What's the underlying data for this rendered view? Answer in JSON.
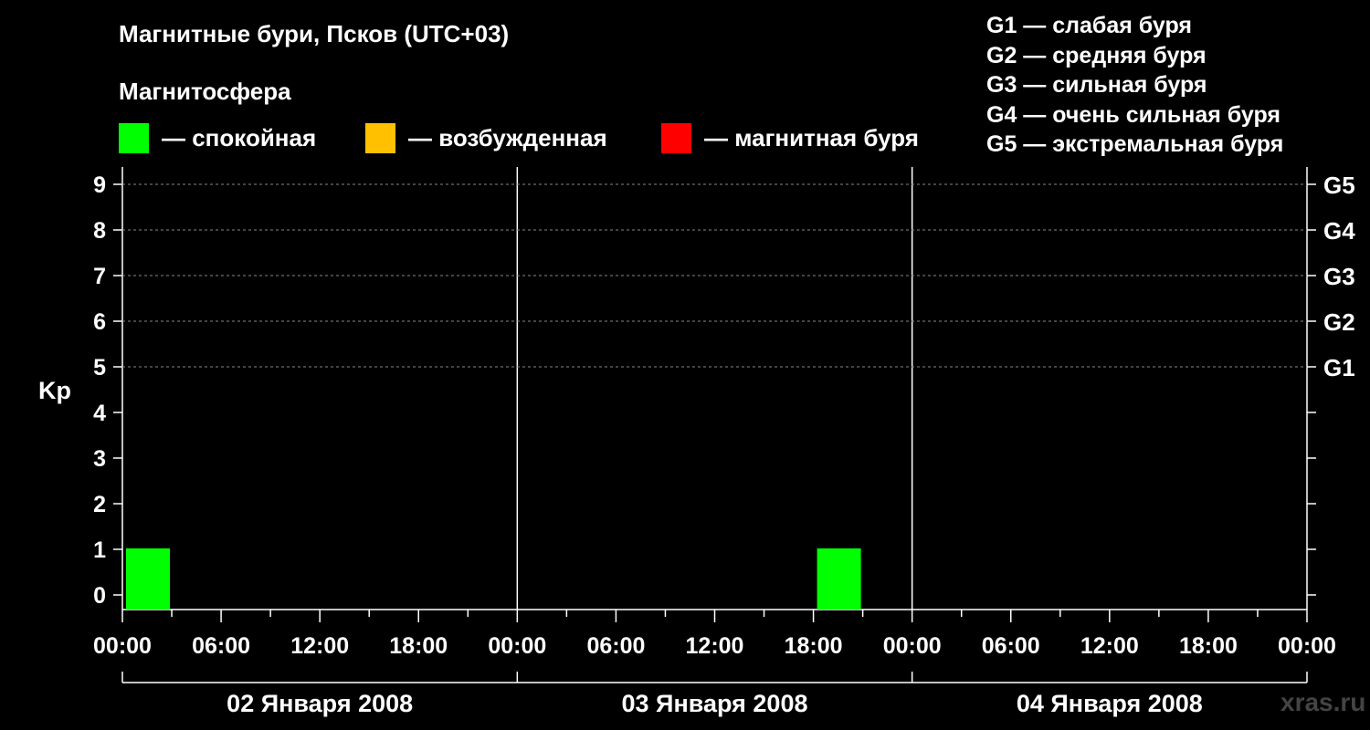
{
  "title": "Магнитные бури, Псков (UTC+03)",
  "subtitle": "Магнитосфера",
  "legend": [
    {
      "label": "— спокойная",
      "color": "#00ff00"
    },
    {
      "label": "— возбужденная",
      "color": "#ffc000"
    },
    {
      "label": "— магнитная буря",
      "color": "#ff0000"
    }
  ],
  "g_legend": [
    "G1 — слабая буря",
    "G2 — средняя буря",
    "G3 — сильная буря",
    "G4 — очень сильная буря",
    "G5 — экстремальная буря"
  ],
  "watermark": "xras.ru",
  "chart_data": {
    "type": "bar",
    "ylabel": "Kp",
    "ylim": [
      0,
      9
    ],
    "y_ticks": [
      "0",
      "1",
      "2",
      "3",
      "4",
      "5",
      "6",
      "7",
      "8",
      "9"
    ],
    "right_ticks": [
      {
        "value": 5,
        "label": "G1"
      },
      {
        "value": 6,
        "label": "G2"
      },
      {
        "value": 7,
        "label": "G3"
      },
      {
        "value": 8,
        "label": "G4"
      },
      {
        "value": 9,
        "label": "G5"
      }
    ],
    "grid": "dashed horizontal at Kp 5–9",
    "x_tick_labels": [
      "00:00",
      "06:00",
      "12:00",
      "18:00",
      "00:00",
      "06:00",
      "12:00",
      "18:00",
      "00:00",
      "06:00",
      "12:00",
      "18:00",
      "00:00"
    ],
    "days": [
      "02 Января 2008",
      "03 Января 2008",
      "04 Января 2008"
    ],
    "bars": [
      {
        "start": "02 Января 2008 00:00",
        "end": "02 Января 2008 03:00",
        "kp": 1,
        "level": "спокойная"
      },
      {
        "start": "03 Января 2008 18:00",
        "end": "03 Января 2008 21:00",
        "kp": 1,
        "level": "спокойная"
      }
    ],
    "colors": {
      "quiet": "#00ff00",
      "unsettled": "#ffc000",
      "storm": "#ff0000"
    }
  }
}
